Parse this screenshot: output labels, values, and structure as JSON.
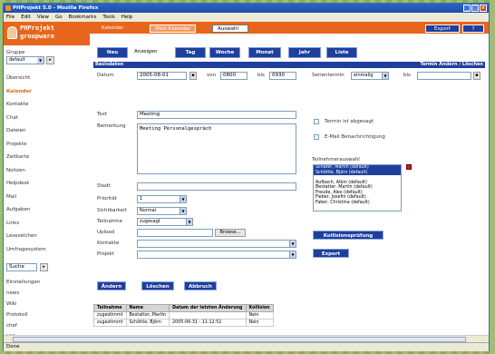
{
  "window": {
    "title": "PHProjekt 5.0 - Mozilla Firefox",
    "status": "Done"
  },
  "menubar": [
    "File",
    "Edit",
    "View",
    "Go",
    "Bookmarks",
    "Tools",
    "Help"
  ],
  "logo": {
    "line1": "PHProjekt",
    "line2": "groupware"
  },
  "topnav": {
    "tab_kalender": "Kalender",
    "tab_mein": "Mein Kalender",
    "tab_auswahl": "Auswahl",
    "export": "Export",
    "help": "?"
  },
  "sidebar": {
    "group_label": "Gruppe",
    "group_value": "default",
    "items": [
      "Übersicht",
      "Kalender",
      "Kontakte",
      "Chat",
      "Dateien",
      "Projekte",
      "Zeitkarte",
      "Notizen",
      "Helpdesk",
      "Mail",
      "Aufgaben",
      "Links",
      "Lesezeichen",
      "Umfragesystem"
    ],
    "search_value": "Suche",
    "items2": [
      "Einstellungen",
      "news",
      "Wiki",
      "Protokoll",
      "chef",
      "Hilfe",
      "Logout"
    ]
  },
  "nav": {
    "neu": "Neu",
    "anzeigen": "Anzeigen",
    "tag": "Tag",
    "woche": "Woche",
    "monat": "Monat",
    "jahr": "Jahr",
    "liste": "Liste"
  },
  "form": {
    "basisdaten": "Basisdaten",
    "termin_links": "Termin Ändern / Löschen",
    "datum_label": "Datum",
    "datum_value": "2005-08-01",
    "von_label": "von",
    "von_value": "0800",
    "bis_label": "bis",
    "bis_value": "0930",
    "serie_label": "Serientermin",
    "serie_value": "einmalig",
    "serie_bis_label": "bis",
    "text_label": "Text",
    "text_value": "Meeting",
    "bemerkung_label": "Bemerkung",
    "bemerkung_value": "Meeting Personalgespräch",
    "chk_abgesagt": "Termin ist abgesagt",
    "chk_email": "E-Mail Benachrichtigung",
    "teilnehmer_auswahl": "Teilnehmerauswahl",
    "teilnehmer_list": [
      "Schäfer, Martin (default)",
      "Schöttle, Björn (default)",
      "",
      "Aufbach, Albin (default)",
      "Bestatter, Martin (default)",
      "Freude, Alex (default)",
      "Fieber, Josefin (default)",
      "Faber, Christina (default)"
    ],
    "teilnehmer_selected": [
      0,
      1
    ],
    "stadt_label": "Stadt",
    "prioritaet_label": "Priorität",
    "prioritaet_value": "1",
    "sichtbarkeit_label": "Sichtbarkeit",
    "sichtbarkeit_value": "Normal",
    "teilnahme_label": "Teilnahme",
    "teilnahme_value": "zugesagt",
    "upload_label": "Upload",
    "browse": "Browse...",
    "kontakte_label": "Kontakte",
    "projekt_label": "Projekt",
    "kollision_btn": "Kollisionsprüfung",
    "export_btn": "Export"
  },
  "actions": {
    "aendern": "Ändern",
    "loeschen": "Löschen",
    "abbruch": "Abbruch"
  },
  "history": {
    "headers": [
      "Teilnahme",
      "Name",
      "Datum der letzten Änderung",
      "Kollision"
    ],
    "rows": [
      [
        "zugestimmt",
        "Bestatter, Martin",
        "",
        "Nein"
      ],
      [
        "zugestimmt",
        "Schöttle, Björn",
        "2005-06-31 - 11:12:52",
        "Nein"
      ]
    ]
  }
}
